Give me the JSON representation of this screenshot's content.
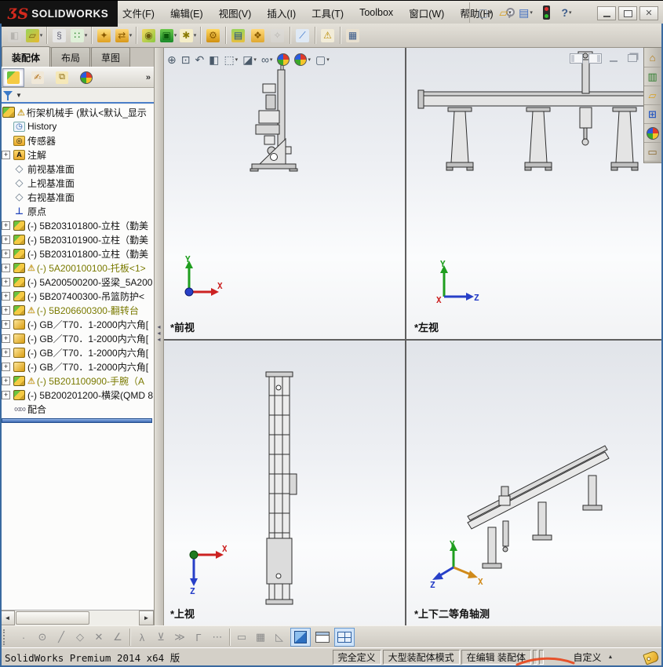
{
  "window": {
    "logo_glyph": "ƷS",
    "brand": "SOLIDWORKS",
    "controls": {
      "minimize": "minimize",
      "restore": "restore",
      "close": "✕"
    }
  },
  "menubar": {
    "items": [
      {
        "key": "file",
        "label": "文件(F)"
      },
      {
        "key": "edit",
        "label": "编辑(E)"
      },
      {
        "key": "view",
        "label": "视图(V)"
      },
      {
        "key": "insert",
        "label": "插入(I)"
      },
      {
        "key": "tools",
        "label": "工具(T)"
      },
      {
        "key": "toolbox",
        "label": "Toolbox"
      },
      {
        "key": "window",
        "label": "窗口(W)"
      },
      {
        "key": "help",
        "label": "帮助(H)"
      }
    ]
  },
  "quick_access": [
    {
      "name": "new-document-button",
      "glyph": "▢",
      "fg": "#7a8aa0",
      "drop": true
    },
    {
      "name": "open-document-button",
      "glyph": "▱",
      "fg": "#d8a020",
      "drop": true
    },
    {
      "name": "save-button",
      "glyph": "▤",
      "fg": "#3a6ac0",
      "drop": true
    },
    {
      "name": "traffic-light-indicator",
      "glyph": "traffic",
      "fg": "",
      "drop": false
    },
    {
      "name": "help-button",
      "glyph": "?",
      "fg": "#3a5a8a",
      "drop": true
    }
  ],
  "toolbar": {
    "buttons": [
      {
        "name": "insert-component-button",
        "glyph": "◧",
        "fg": "#888",
        "bg": "#d8d8d8",
        "dim": true
      },
      {
        "name": "open-part-button",
        "glyph": "▱",
        "fg": "#7a5a10",
        "bg": "linear-gradient(135deg,#9ad45a,#e8b830)",
        "drop": true
      },
      {
        "name": "mate-button",
        "glyph": "§",
        "fg": "#667",
        "bg": "#e6e6e6",
        "sep": true
      },
      {
        "name": "linear-pattern-button",
        "glyph": "∷",
        "fg": "#1a7a1a",
        "bg": "#dff0d8",
        "drop": true
      },
      {
        "name": "smart-fasteners-button",
        "glyph": "✦",
        "fg": "#8a5a00",
        "bg": "linear-gradient(#ffe080,#e0a020)",
        "sep": true
      },
      {
        "name": "move-component-button",
        "glyph": "⇄",
        "fg": "#8a5a00",
        "bg": "linear-gradient(#ffd878,#d89818)",
        "drop": true
      },
      {
        "name": "show-hidden-button",
        "glyph": "◉",
        "fg": "#6a5a10",
        "bg": "linear-gradient(135deg,#f5d860,#8ac840)",
        "sep": true
      },
      {
        "name": "assembly-features-button",
        "glyph": "▣",
        "fg": "#0a5a0a",
        "bg": "linear-gradient(#6ac84a,#1a8a2a)",
        "drop": true
      },
      {
        "name": "reference-geometry-button",
        "glyph": "✱",
        "fg": "#8a7a00",
        "bg": "#f5eec8",
        "drop": true
      },
      {
        "name": "motion-study-button",
        "glyph": "⚙",
        "fg": "#8a5a00",
        "bg": "linear-gradient(#ffd860,#d09010)",
        "sep": true
      },
      {
        "name": "bom-window-button",
        "glyph": "▤",
        "fg": "#1a4a8a",
        "bg": "linear-gradient(#9ad45a,#e8c040)",
        "sep": true
      },
      {
        "name": "exploded-view-button",
        "glyph": "❖",
        "fg": "#8a5a00",
        "bg": "linear-gradient(#ffd878,#e0a830)"
      },
      {
        "name": "explode-line-sketch-button",
        "glyph": "✧",
        "fg": "#888",
        "bg": "#dcdcdc",
        "dim": true
      },
      {
        "name": "curvature-button",
        "glyph": "⟋",
        "fg": "#2a6ac8",
        "bg": "#dfe9f5",
        "sep": true
      },
      {
        "name": "interference-detection-button",
        "glyph": "⚠",
        "fg": "#b88a00",
        "bg": "#f2ecd8",
        "sep": true
      },
      {
        "name": "appearance-image-button",
        "glyph": "▦",
        "fg": "#3a5a8a",
        "bg": "#e8e0d0",
        "sep": true
      }
    ]
  },
  "left_panel": {
    "tabs": [
      {
        "name": "tab-assembly",
        "label": "装配体",
        "active": true
      },
      {
        "name": "tab-layout",
        "label": "布局",
        "active": false
      },
      {
        "name": "tab-sketch",
        "label": "草图",
        "active": false
      }
    ],
    "fm_tabs": [
      {
        "name": "featuremanager-tree-tab",
        "glyph": "",
        "bg": "linear-gradient(135deg,#6cc43e 0 34%,#f5ca44 34%)",
        "fg": "#fff",
        "active": true
      },
      {
        "name": "propertymanager-tab",
        "glyph": "✍",
        "bg": "#f0e8d8",
        "fg": "#b06a10",
        "active": false
      },
      {
        "name": "configurationmanager-tab",
        "glyph": "⧉",
        "bg": "#f5e8b8",
        "fg": "#8a6a10",
        "active": false
      },
      {
        "name": "displaymanager-tab",
        "glyph": "ball",
        "bg": "",
        "fg": "",
        "active": false
      }
    ],
    "fm_more": "»",
    "filter": {
      "name": "filter-button"
    },
    "tree": {
      "icon_glyphs": {
        "hist": "◷",
        "folder-sensor": "◎",
        "folder-ann": "A",
        "plane": "◇",
        "origin": "⊥",
        "mates": "∞∞"
      },
      "items": [
        {
          "name": "tree-root-assembly",
          "label": "桁架机械手 (默认<默认_显示",
          "icon": "asm-root",
          "root": true,
          "warn": true
        },
        {
          "name": "tree-item-history",
          "label": "History",
          "icon": "hist"
        },
        {
          "name": "tree-item-sensors",
          "label": "传感器",
          "icon": "folder-sensor"
        },
        {
          "name": "tree-item-annotations",
          "label": "注解",
          "icon": "folder-ann",
          "expand": true
        },
        {
          "name": "tree-item-front-plane",
          "label": "前视基准面",
          "icon": "plane"
        },
        {
          "name": "tree-item-top-plane",
          "label": "上视基准面",
          "icon": "plane"
        },
        {
          "name": "tree-item-right-plane",
          "label": "右视基准面",
          "icon": "plane"
        },
        {
          "name": "tree-item-origin",
          "label": "原点",
          "icon": "origin"
        },
        {
          "name": "tree-item-column-1",
          "label": "(-) 5B203101800-立柱（勤美",
          "icon": "asm",
          "expand": true
        },
        {
          "name": "tree-item-column-2",
          "label": "(-) 5B203101900-立柱（勤美",
          "icon": "asm",
          "expand": true
        },
        {
          "name": "tree-item-column-3",
          "label": "(-) 5B203101800-立柱（勤美",
          "icon": "asm",
          "expand": true
        },
        {
          "name": "tree-item-pallet",
          "label": "(-) 5A200100100-托板<1>",
          "icon": "asm",
          "expand": true,
          "warn": true,
          "olive": true
        },
        {
          "name": "tree-item-vertical-beam",
          "label": "(-) 5A200500200-竖梁_5A200",
          "icon": "asm",
          "expand": true
        },
        {
          "name": "tree-item-basket-guard",
          "label": "(-) 5B207400300-吊篮防护<",
          "icon": "asm",
          "expand": true
        },
        {
          "name": "tree-item-turn-table",
          "label": "(-) 5B206600300-翻转台",
          "icon": "asm",
          "expand": true,
          "warn": true,
          "olive": true
        },
        {
          "name": "tree-item-screw-1",
          "label": "(-) GB／T70．1-2000内六角[",
          "icon": "part",
          "expand": true
        },
        {
          "name": "tree-item-screw-2",
          "label": "(-) GB／T70．1-2000内六角[",
          "icon": "part",
          "expand": true
        },
        {
          "name": "tree-item-screw-3",
          "label": "(-) GB／T70．1-2000内六角[",
          "icon": "part",
          "expand": true
        },
        {
          "name": "tree-item-screw-4",
          "label": "(-) GB／T70．1-2000内六角[",
          "icon": "part",
          "expand": true
        },
        {
          "name": "tree-item-wrist",
          "label": "(-) 5B201100900-手腕（A",
          "icon": "asm",
          "expand": true,
          "warn": true,
          "olive": true
        },
        {
          "name": "tree-item-cross-beam",
          "label": "(-) 5B200201200-横梁(QMD 8",
          "icon": "asm",
          "expand": true
        },
        {
          "name": "tree-item-mates",
          "label": "配合",
          "icon": "mates"
        }
      ]
    }
  },
  "graphics": {
    "headsup": [
      {
        "name": "zoom-fit-button",
        "glyph": "⊕"
      },
      {
        "name": "zoom-area-button",
        "glyph": "⊡"
      },
      {
        "name": "previous-view-button",
        "glyph": "↶"
      },
      {
        "name": "section-view-button",
        "glyph": "◧"
      },
      {
        "name": "view-orientation-button",
        "glyph": "⬚",
        "drop": true
      },
      {
        "name": "display-style-button",
        "glyph": "◪",
        "drop": true
      },
      {
        "name": "hide-show-items-button",
        "glyph": "∞",
        "drop": true
      },
      {
        "name": "edit-appearance-button",
        "glyph": "ball"
      },
      {
        "name": "apply-scene-button",
        "glyph": "ball",
        "drop": true
      },
      {
        "name": "view-settings-button",
        "glyph": "▢",
        "drop": true
      }
    ],
    "doc_controls": [
      {
        "name": "collapse-left-pane-button",
        "kind": "pane-l"
      },
      {
        "name": "collapse-right-pane-button",
        "kind": "pane-r"
      },
      {
        "name": "doc-minimize-button",
        "kind": "min"
      },
      {
        "name": "doc-restore-button",
        "kind": "rest"
      },
      {
        "name": "doc-close-button",
        "kind": "close",
        "glyph": "✕"
      }
    ],
    "viewports": [
      {
        "label": "*前视",
        "triad": {
          "up": "Y",
          "right": "X"
        }
      },
      {
        "label": "*左视",
        "triad": {
          "up": "Y",
          "right": "Z",
          "origin": "X"
        }
      },
      {
        "label": "*上视",
        "triad": {
          "right": "X",
          "down": "Z"
        }
      },
      {
        "label": "*上下二等角轴测",
        "triad": {
          "up": "Y",
          "lower_right": "X",
          "lower_left": "Z"
        }
      }
    ]
  },
  "task_pane": [
    {
      "name": "solidworks-resources-button",
      "glyph": "⌂",
      "fg": "#b07a10"
    },
    {
      "name": "design-library-button",
      "glyph": "▥",
      "fg": "#2a7a2a"
    },
    {
      "name": "file-explorer-button",
      "glyph": "▱",
      "fg": "#d8a020"
    },
    {
      "name": "view-palette-button",
      "glyph": "⊞",
      "fg": "#2a5ac0"
    },
    {
      "name": "appearances-scenes-button",
      "glyph": "ball",
      "fg": ""
    },
    {
      "name": "custom-properties-button",
      "glyph": "▭",
      "fg": "#8a6a30"
    }
  ],
  "bottom_toolbar": {
    "sketch_icons": [
      {
        "name": "sketch-point-tool",
        "glyph": "·"
      },
      {
        "name": "sketch-circle-tool",
        "glyph": "⊙"
      },
      {
        "name": "sketch-line-tool",
        "glyph": "╱"
      },
      {
        "name": "sketch-polygon-tool",
        "glyph": "◇"
      },
      {
        "name": "sketch-intersect-tool",
        "glyph": "✕"
      },
      {
        "name": "sketch-angle-tool",
        "glyph": "∠"
      },
      {
        "name": "snap-tangent-tool",
        "glyph": "λ",
        "sep": true
      },
      {
        "name": "snap-perpendicular-tool",
        "glyph": "⊻"
      },
      {
        "name": "snap-parallel-tool",
        "glyph": "≫"
      },
      {
        "name": "snap-hv-tool",
        "glyph": "Γ"
      },
      {
        "name": "snap-points-tool",
        "glyph": "⋯"
      },
      {
        "name": "snap-length-tool",
        "glyph": "▭",
        "sep": true
      },
      {
        "name": "grid-snap-tool",
        "glyph": "▦"
      },
      {
        "name": "angle-snap-tool",
        "glyph": "◺"
      }
    ],
    "view_buttons": [
      {
        "name": "shaded-view-button",
        "kind": "cube",
        "pressed": true
      },
      {
        "name": "single-view-button",
        "kind": "pane1",
        "pressed": false
      },
      {
        "name": "four-view-button",
        "kind": "pane4",
        "pressed": true
      }
    ]
  },
  "status_bar": {
    "left": "SolidWorks Premium 2014 x64 版",
    "cells": [
      {
        "name": "status-fully-defined",
        "label": "完全定义"
      },
      {
        "name": "status-large-assembly-mode",
        "label": "大型装配体模式"
      },
      {
        "name": "status-editing-assembly",
        "label": "在编辑 装配体"
      },
      {
        "name": "status-sep-1",
        "label": ""
      },
      {
        "name": "status-sep-2",
        "label": ""
      }
    ],
    "custom": "自定义"
  }
}
